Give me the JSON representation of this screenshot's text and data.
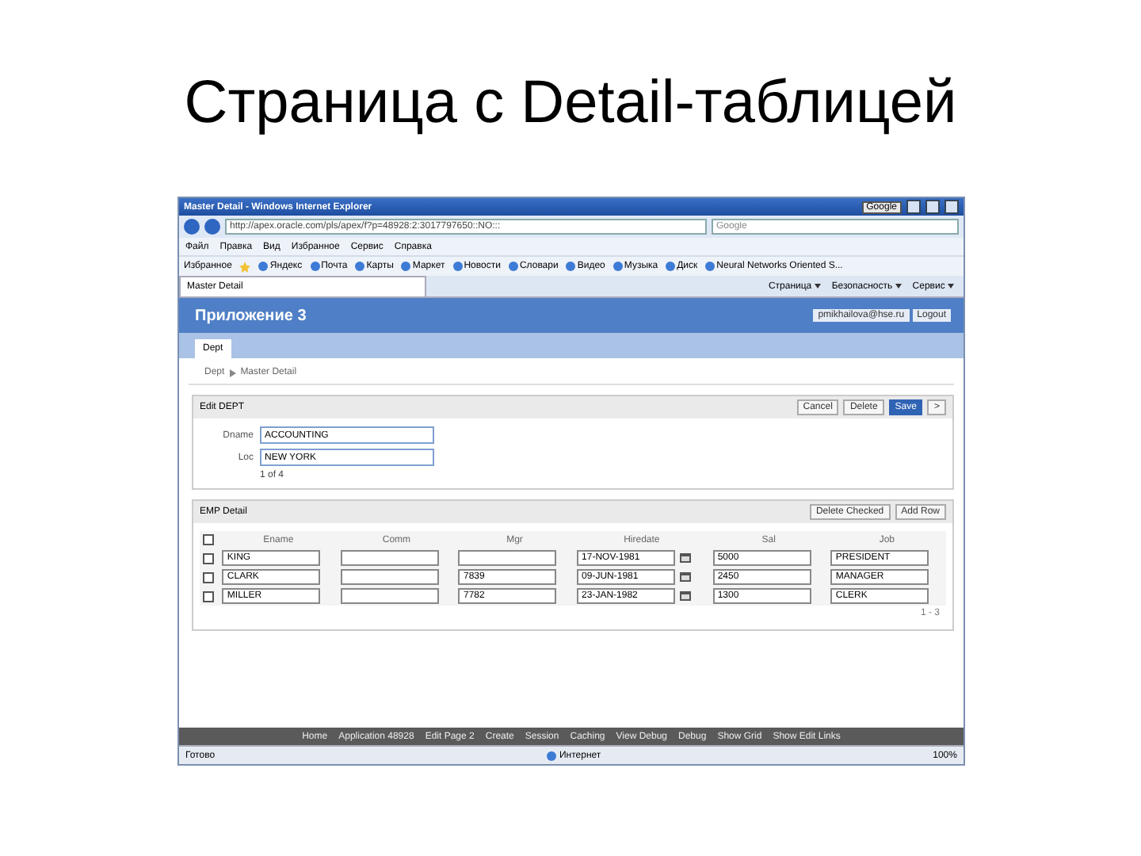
{
  "slide": {
    "title": "Страница с Detail-таблицей"
  },
  "browser": {
    "window_title": "Master Detail - Windows Internet Explorer",
    "search_button": "Google",
    "address": "http://apex.oracle.com/pls/apex/f?p=48928:2:3017797650::NO:::",
    "search_placeholder": "Google",
    "menu": [
      "Файл",
      "Правка",
      "Вид",
      "Избранное",
      "Сервис",
      "Справка"
    ],
    "favorites_label": "Избранное",
    "favorites": [
      "Яндекс",
      "Почта",
      "Карты",
      "Маркет",
      "Новости",
      "Словари",
      "Видео",
      "Музыка",
      "Диск",
      "Neural Networks Oriented S..."
    ],
    "tab": {
      "label": "Master Detail",
      "selected": true
    },
    "commands": [
      "Страница",
      "Безопасность",
      "Сервис"
    ],
    "status": "Готово",
    "zone": "Интернет",
    "zoom": "100%"
  },
  "app": {
    "title": "Приложение 3",
    "user": "pmikhailova@hse.ru",
    "logout": "Logout",
    "tabs": [
      {
        "label": "Dept",
        "selected": true
      }
    ],
    "breadcrumb": [
      "Dept",
      "Master Detail"
    ],
    "master": {
      "title": "Edit DEPT",
      "buttons": [
        {
          "label": "Cancel",
          "kind": "plain"
        },
        {
          "label": "Delete",
          "kind": "plain"
        },
        {
          "label": "Save",
          "kind": "primary"
        },
        {
          "label": ">",
          "kind": "plain"
        }
      ],
      "fields": [
        {
          "label": "Dname",
          "value": "ACCOUNTING"
        },
        {
          "label": "Loc",
          "value": "NEW YORK"
        }
      ],
      "pagination": "1 of 4"
    },
    "detail": {
      "title": "EMP Detail",
      "buttons": [
        {
          "label": "Delete Checked"
        },
        {
          "label": "Add Row"
        }
      ],
      "header_checked": false,
      "columns": [
        {
          "label": "Ename",
          "kind": "text"
        },
        {
          "label": "Comm",
          "kind": "text"
        },
        {
          "label": "Mgr",
          "kind": "text"
        },
        {
          "label": "Hiredate",
          "kind": "date"
        },
        {
          "label": "Sal",
          "kind": "text"
        },
        {
          "label": "Job",
          "kind": "text"
        }
      ],
      "rows": [
        {
          "checked": false,
          "cells": [
            "KING",
            "",
            "",
            "17-NOV-1981",
            "5000",
            "PRESIDENT"
          ]
        },
        {
          "checked": false,
          "cells": [
            "CLARK",
            "",
            "7839",
            "09-JUN-1981",
            "2450",
            "MANAGER"
          ]
        },
        {
          "checked": false,
          "cells": [
            "MILLER",
            "",
            "7782",
            "23-JAN-1982",
            "1300",
            "CLERK"
          ]
        }
      ],
      "pagination": "1 - 3"
    },
    "footer_links": [
      "Home",
      "Application 48928",
      "Edit Page 2",
      "Create",
      "Session",
      "Caching",
      "View Debug",
      "Debug",
      "Show Grid",
      "Show Edit Links"
    ]
  }
}
